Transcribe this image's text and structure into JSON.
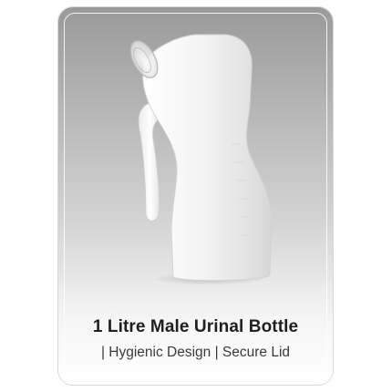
{
  "product": {
    "title": "1 Litre Male Urinal Bottle",
    "subtitle": "| Hygienic Design | Secure Lid"
  }
}
